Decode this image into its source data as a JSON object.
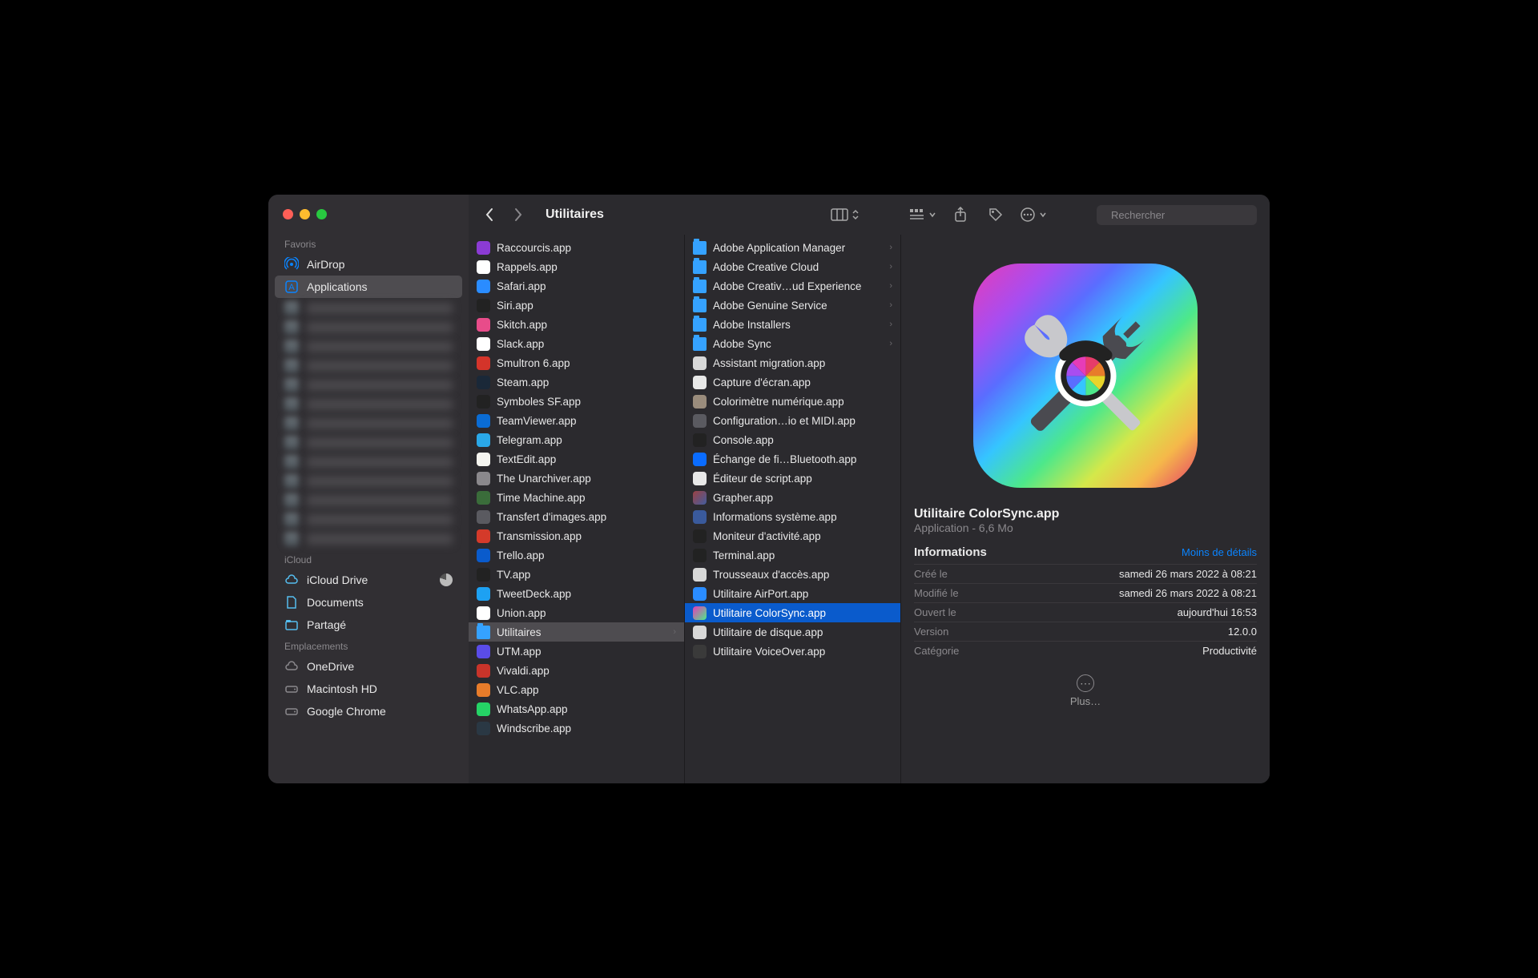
{
  "window_title": "Utilitaires",
  "search": {
    "placeholder": "Rechercher"
  },
  "sidebar": {
    "sections": [
      {
        "label": "Favoris",
        "items": [
          {
            "label": "AirDrop",
            "icon": "airdrop",
            "selected": false
          },
          {
            "label": "Applications",
            "icon": "apps",
            "selected": true
          }
        ],
        "blurred_count": 13
      },
      {
        "label": "iCloud",
        "items": [
          {
            "label": "iCloud Drive",
            "icon": "cloud",
            "pie": true
          },
          {
            "label": "Documents",
            "icon": "doc"
          },
          {
            "label": "Partagé",
            "icon": "shared-folder"
          }
        ]
      },
      {
        "label": "Emplacements",
        "items": [
          {
            "label": "OneDrive",
            "icon": "cloud-gray"
          },
          {
            "label": "Macintosh HD",
            "icon": "disk"
          },
          {
            "label": "Google Chrome",
            "icon": "disk"
          }
        ]
      }
    ]
  },
  "column1": [
    {
      "label": "Raccourcis.app",
      "bg": "#8b3bd4"
    },
    {
      "label": "Rappels.app",
      "bg": "#ffffff"
    },
    {
      "label": "Safari.app",
      "bg": "#2a8cff"
    },
    {
      "label": "Siri.app",
      "bg": "#222"
    },
    {
      "label": "Skitch.app",
      "bg": "#e84c8a"
    },
    {
      "label": "Slack.app",
      "bg": "#fff"
    },
    {
      "label": "Smultron 6.app",
      "bg": "#d4342a"
    },
    {
      "label": "Steam.app",
      "bg": "#1a2838"
    },
    {
      "label": "Symboles SF.app",
      "bg": "#222"
    },
    {
      "label": "TeamViewer.app",
      "bg": "#0a6cd4"
    },
    {
      "label": "Telegram.app",
      "bg": "#2aa8e8"
    },
    {
      "label": "TextEdit.app",
      "bg": "#f5f5f0"
    },
    {
      "label": "The Unarchiver.app",
      "bg": "#8a888c"
    },
    {
      "label": "Time Machine.app",
      "bg": "#3a6c3a"
    },
    {
      "label": "Transfert d'images.app",
      "bg": "#5a5a60"
    },
    {
      "label": "Transmission.app",
      "bg": "#d43a2a"
    },
    {
      "label": "Trello.app",
      "bg": "#0a5bcc"
    },
    {
      "label": "TV.app",
      "bg": "#222"
    },
    {
      "label": "TweetDeck.app",
      "bg": "#1da1f2"
    },
    {
      "label": "Union.app",
      "bg": "#fff"
    },
    {
      "label": "Utilitaires",
      "folder": true,
      "selected": true
    },
    {
      "label": "UTM.app",
      "bg": "#5a4ce8"
    },
    {
      "label": "Vivaldi.app",
      "bg": "#c8342a"
    },
    {
      "label": "VLC.app",
      "bg": "#e87c2a"
    },
    {
      "label": "WhatsApp.app",
      "bg": "#25d366"
    },
    {
      "label": "Windscribe.app",
      "bg": "#2a3844"
    }
  ],
  "column2": [
    {
      "label": "Adobe Application Manager",
      "folder": true
    },
    {
      "label": "Adobe Creative Cloud",
      "folder": true
    },
    {
      "label": "Adobe Creativ…ud Experience",
      "folder": true
    },
    {
      "label": "Adobe Genuine Service",
      "folder": true
    },
    {
      "label": "Adobe Installers",
      "folder": true
    },
    {
      "label": "Adobe Sync",
      "folder": true
    },
    {
      "label": "Assistant migration.app",
      "bg": "#d8d8d8"
    },
    {
      "label": "Capture d'écran.app",
      "bg": "#e8e8e8"
    },
    {
      "label": "Colorimètre numérique.app",
      "bg": "#9a8c7c"
    },
    {
      "label": "Configuration…io et MIDI.app",
      "bg": "#5a5a60"
    },
    {
      "label": "Console.app",
      "bg": "#222"
    },
    {
      "label": "Échange de fi…Bluetooth.app",
      "bg": "#0a6cff"
    },
    {
      "label": "Éditeur de script.app",
      "bg": "#e8e8e8"
    },
    {
      "label": "Grapher.app",
      "bg": "linear-gradient(135deg,#f558,#58f8)"
    },
    {
      "label": "Informations système.app",
      "bg": "#3a5a9c"
    },
    {
      "label": "Moniteur d'activité.app",
      "bg": "#222"
    },
    {
      "label": "Terminal.app",
      "bg": "#222"
    },
    {
      "label": "Trousseaux d'accès.app",
      "bg": "#d8d8d8"
    },
    {
      "label": "Utilitaire AirPort.app",
      "bg": "#2a8cff"
    },
    {
      "label": "Utilitaire ColorSync.app",
      "bg": "linear-gradient(135deg,#e63cb8,#4de88a)",
      "selected": true
    },
    {
      "label": "Utilitaire de disque.app",
      "bg": "#d8d8d8"
    },
    {
      "label": "Utilitaire VoiceOver.app",
      "bg": "#3a3a3a"
    }
  ],
  "preview": {
    "name": "Utilitaire ColorSync.app",
    "kind_line": "Application - 6,6 Mo",
    "section": "Informations",
    "toggle": "Moins de détails",
    "rows": [
      {
        "k": "Créé le",
        "v": "samedi 26 mars 2022 à 08:21"
      },
      {
        "k": "Modifié le",
        "v": "samedi 26 mars 2022 à 08:21"
      },
      {
        "k": "Ouvert le",
        "v": "aujourd'hui 16:53"
      },
      {
        "k": "Version",
        "v": "12.0.0"
      },
      {
        "k": "Catégorie",
        "v": "Productivité"
      }
    ],
    "more": "Plus…"
  }
}
